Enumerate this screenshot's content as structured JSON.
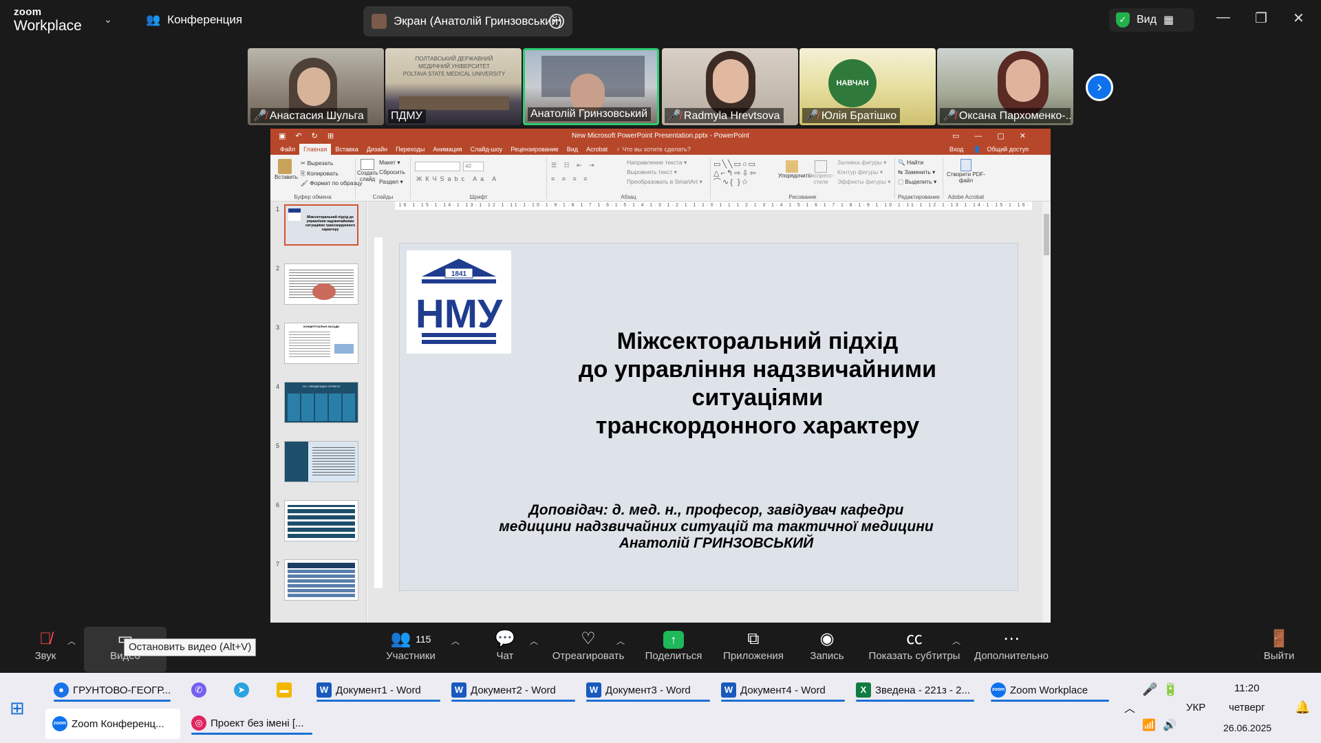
{
  "topbar": {
    "brand_small": "zoom",
    "brand_large": "Workplace",
    "meeting_label": "Конференция",
    "share_tab": "Экран (Анатолій Гринзовський)",
    "view_label": "Вид"
  },
  "participants": [
    {
      "name": "Анастасия Шульга",
      "muted": true
    },
    {
      "name": "ПДМУ",
      "muted": false
    },
    {
      "name": "Анатолій Гринзовський",
      "muted": false,
      "active": true
    },
    {
      "name": "Radmyla Hrevtsova",
      "muted": true
    },
    {
      "name": "Юлія Братішко",
      "muted": true
    },
    {
      "name": "Оксана Пархоменко-...",
      "muted": true
    }
  ],
  "ppt": {
    "window_title": "New Microsoft PowerPoint Presentation.pptx - PowerPoint",
    "menu": [
      "Файл",
      "Главная",
      "Вставка",
      "Дизайн",
      "Переходы",
      "Анимация",
      "Слайд-шоу",
      "Рецензирование",
      "Вид",
      "Acrobat",
      "♀ Что вы хотите сделать?"
    ],
    "signin": "Вход",
    "share": "Общий доступ",
    "ribbon": {
      "paste": "Вставить",
      "cut": "Вырезать",
      "copy": "Копировать",
      "format_painter": "Формат по образцу",
      "clipboard": "Буфер обмена",
      "new_slide": "Создать слайд",
      "layout": "Макет",
      "reset": "Сбросить",
      "section": "Раздел",
      "slides": "Слайды",
      "font_size": "40",
      "font": "Шрифт",
      "text_direction": "Направление текста",
      "align_text": "Выровнять текст",
      "smartart": "Преобразовать в SmartArt",
      "paragraph": "Абзац",
      "arrange": "Упорядочить",
      "quick_styles": "Экспресс-стили",
      "shape_fill": "Заливка фигуры",
      "shape_outline": "Контур фигуры",
      "shape_effects": "Эффекты фигуры",
      "drawing": "Рисование",
      "find": "Найти",
      "replace": "Заменить",
      "select": "Выделить",
      "editing": "Редактирование",
      "create_pdf": "Створити PDF-файл",
      "adobe": "Adobe Acrobat"
    },
    "ruler": "·16·1·15·1·14·1·13·1·12·1·11·1·10·1·9·1·8·1·7·1·6·1·5·1·4·1·3·1·2·1·1·1·0·1·1·1·2·1·3·1·4·1·5·1·6·1·7·1·8·1·9·1·10·1·11·1·12·1·13·1·14·1·15·1·16·",
    "thumbnails": [
      "1",
      "2",
      "3",
      "4",
      "5",
      "6",
      "7"
    ],
    "slide": {
      "logo_year": "1841",
      "logo_text": "НМУ",
      "title_lines": [
        "Міжсекторальний підхід",
        "до управління надзвичайними",
        "ситуаціями",
        "транскордонного характеру"
      ],
      "subtitle_lines": [
        "Доповідач: д. мед. н., професор, завідувач кафедри",
        "медицини надзвичайних ситуацій та тактичної медицини",
        "Анатолій ГРИНЗОВСЬКИЙ"
      ],
      "thumb_title": "Міжсекторальний підхід до управління надзвичайними ситуаціями транскордонного характеру",
      "thumb4_title": "НС і НЕВІДКЛАДНІ СЕРВІСИ",
      "thumb3_title": "КОНЦЕПТУАЛЬНІ ЗАСАДИ"
    }
  },
  "controls": {
    "audio": "Звук",
    "video": "Видео",
    "video_tooltip": "Остановить видео (Alt+V)",
    "participants": "Участники",
    "participants_count": "115",
    "chat": "Чат",
    "react": "Отреагировать",
    "share": "Поделиться",
    "apps": "Приложения",
    "record": "Запись",
    "captions": "Показать субтитры",
    "more": "Дополнительно",
    "leave": "Выйти"
  },
  "taskbar": {
    "row1": [
      "ГРУНТОВО-ГЕОГР...",
      "Документ1 - Word",
      "Документ2 - Word",
      "Документ3 - Word",
      "Документ4 - Word",
      "Зведена - 221з - 2...",
      "Zoom Workplace"
    ],
    "row2": [
      "Zoom Конференц...",
      "Проект без імені [..."
    ],
    "lang": "УКР",
    "time": "11:20",
    "day": "четверг",
    "date": "26.06.2025"
  },
  "colors": {
    "ppt_red": "#b7472a",
    "zoom_blue": "#0e72ed",
    "active_green": "#2ecc71",
    "share_green": "#1fb85b",
    "logo_blue": "#1f3c8f"
  }
}
